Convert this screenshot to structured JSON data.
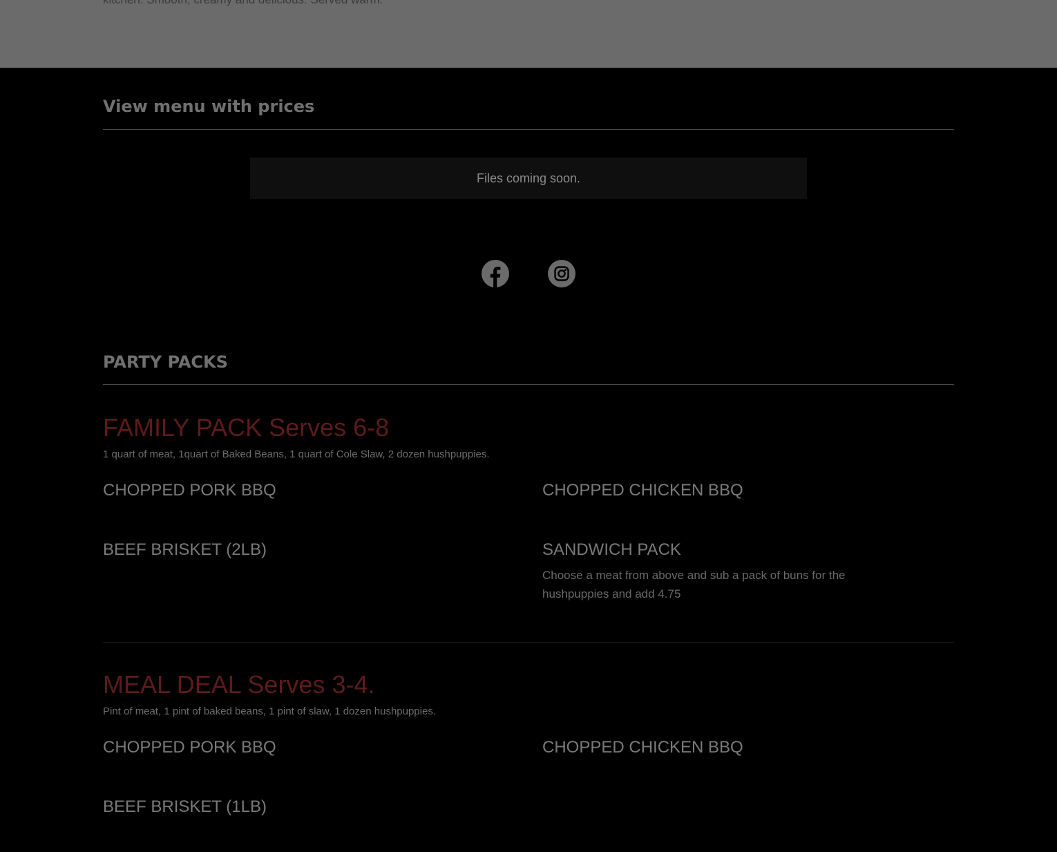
{
  "top_band": {
    "description_fragment": "kitchen. Smooth, creamy and delicious. Served warm."
  },
  "menu_files": {
    "heading": "View menu with prices",
    "empty_message": "Files coming soon."
  },
  "social": {
    "facebook_icon": "facebook-icon",
    "instagram_icon": "instagram-icon"
  },
  "party_packs": {
    "heading": "PARTY PACKS",
    "packs": [
      {
        "title": "FAMILY PACK Serves 6-8",
        "description": "1 quart of meat, 1quart of Baked Beans, 1 quart of Cole Slaw, 2 dozen hushpuppies.",
        "items": [
          {
            "name": "CHOPPED PORK BBQ",
            "description": ""
          },
          {
            "name": "CHOPPED CHICKEN BBQ",
            "description": ""
          },
          {
            "name": "BEEF BRISKET (2LB)",
            "description": ""
          },
          {
            "name": "SANDWICH PACK",
            "description": "Choose a meat from above and sub a pack of buns for the hushpuppies and add 4.75"
          }
        ]
      },
      {
        "title": "MEAL DEAL Serves 3-4.",
        "description": "Pint of meat, 1 pint of baked beans, 1 pint of slaw, 1 dozen hushpuppies.",
        "items": [
          {
            "name": "CHOPPED PORK BBQ",
            "description": ""
          },
          {
            "name": "CHOPPED CHICKEN BBQ",
            "description": ""
          },
          {
            "name": "BEEF BRISKET (1LB)",
            "description": ""
          }
        ]
      }
    ]
  },
  "colors": {
    "page_background": "#000000",
    "top_band": "#6b6b6b",
    "pack_title": "#5e1b1b"
  }
}
